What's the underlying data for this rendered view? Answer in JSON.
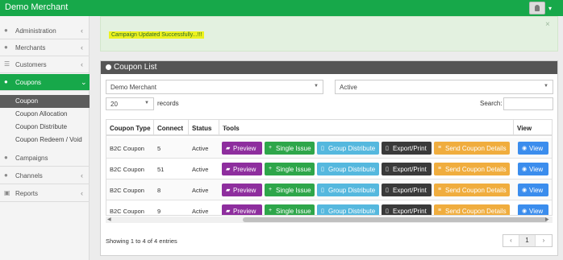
{
  "header": {
    "title": "Demo Merchant"
  },
  "sidebar": {
    "items": [
      {
        "label": "Administration",
        "icon": "users-icon"
      },
      {
        "label": "Merchants",
        "icon": "users-icon"
      },
      {
        "label": "Customers",
        "icon": "list-icon"
      },
      {
        "label": "Coupons",
        "icon": "users-icon"
      },
      {
        "label": "Campaigns",
        "icon": "users-icon"
      },
      {
        "label": "Channels",
        "icon": "users-icon"
      },
      {
        "label": "Reports",
        "icon": "cart-icon"
      }
    ],
    "coupon_sub": [
      "Coupon",
      "Coupon Allocation",
      "Coupon Distribute",
      "Coupon Redeem / Void"
    ]
  },
  "alert": {
    "message": "Campaign Updated Successfully...!!!",
    "close": "×"
  },
  "panel": {
    "title": "Coupon List",
    "merchant_select": "Demo Merchant",
    "status_select": "Active",
    "page_size": "20",
    "records_label": "records",
    "search_label": "Search:"
  },
  "table": {
    "headers": [
      "Coupon Type",
      "Connect",
      "Status",
      "Tools",
      "View"
    ],
    "rows": [
      {
        "type": "B2C Coupon",
        "connect": "5",
        "status": "Active"
      },
      {
        "type": "B2C Coupon",
        "connect": "51",
        "status": "Active"
      },
      {
        "type": "B2C Coupon",
        "connect": "8",
        "status": "Active"
      },
      {
        "type": "B2C Coupon",
        "connect": "9",
        "status": "Active"
      }
    ],
    "buttons": {
      "preview": "Preview",
      "single_issue": "Single Issue",
      "group_distribute": "Group Distribute",
      "export_print": "Export/Print",
      "send_details": "Send Coupon Details",
      "view": "View"
    }
  },
  "footer": {
    "info": "Showing 1 to 4 of 4 entries",
    "page": "1",
    "prev": "‹",
    "next": "›"
  },
  "colors": {
    "brand": "#17a84a",
    "preview": "#8e2e9e",
    "issue": "#2ea64a",
    "group": "#55b8de",
    "export": "#3a3a3a",
    "send": "#f0ad3e",
    "view": "#3b8ded"
  }
}
